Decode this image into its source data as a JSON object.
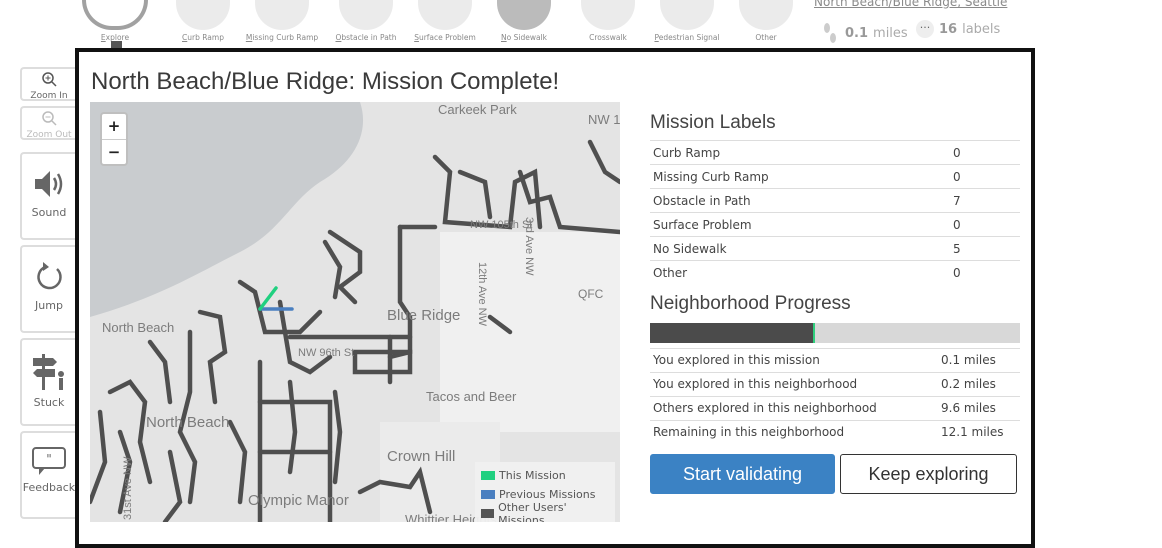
{
  "toolbar": {
    "tools": [
      {
        "label": "Explore",
        "key": "E",
        "rest": "xplore"
      },
      {
        "label": "Curb Ramp",
        "key": "C",
        "rest": "urb Ramp"
      },
      {
        "label": "Missing Curb Ramp",
        "key": "M",
        "rest": "issing Curb Ramp"
      },
      {
        "label": "Obstacle in Path",
        "key": "O",
        "rest": "bstacle in Path"
      },
      {
        "label": "Surface Problem",
        "key": "S",
        "rest": "urface Problem"
      },
      {
        "label": "No Sidewalk",
        "key": "N",
        "rest": "o Sidewalk"
      },
      {
        "label": "Crosswalk",
        "key": "",
        "rest": "Crosswalk"
      },
      {
        "label": "Pedestrian Signal",
        "key": "P",
        "rest": "edestrian Signal"
      },
      {
        "label": "Other",
        "key": "",
        "rest": "Other"
      }
    ],
    "neighborhood_link": "North Beach/Blue Ridge, Seattle",
    "distance_value": "0.1",
    "distance_unit": "miles",
    "labels_value": "16",
    "labels_unit": "labels"
  },
  "sidebar": {
    "zoom_in": "Zoom In",
    "zoom_out": "Zoom Out",
    "sound": "Sound",
    "jump": "Jump",
    "stuck": "Stuck",
    "feedback": "Feedback"
  },
  "modal": {
    "title": "North Beach/Blue Ridge: Mission Complete!",
    "map": {
      "zoom_in": "+",
      "zoom_out": "−",
      "place_labels": {
        "carkeek": "Carkeek Park",
        "nw100": "NW 100",
        "nw105": "NW 105th St",
        "ave3": "3rd Ave NW",
        "ave12": "12th Ave NW",
        "blue_ridge": "Blue Ridge",
        "qfc": "QFC",
        "north_beach_top": "North Beach",
        "nw96": "NW 96th St",
        "north_beach": "North Beach",
        "tacos": "Tacos and Beer",
        "crown_hill": "Crown Hill",
        "olympic": "Olympic Manor",
        "ave31": "31st Ave NW",
        "whittier": "Whittier Heights"
      },
      "legend": [
        {
          "label": "This Mission",
          "color": "#20d080"
        },
        {
          "label": "Previous Missions",
          "color": "#4a7fc0"
        },
        {
          "label": "Other Users' Missions",
          "color": "#555555"
        }
      ]
    },
    "mission_labels": {
      "title": "Mission Labels",
      "rows": [
        {
          "name": "Curb Ramp",
          "count": "0"
        },
        {
          "name": "Missing Curb Ramp",
          "count": "0"
        },
        {
          "name": "Obstacle in Path",
          "count": "7"
        },
        {
          "name": "Surface Problem",
          "count": "0"
        },
        {
          "name": "No Sidewalk",
          "count": "5"
        },
        {
          "name": "Other",
          "count": "0"
        }
      ]
    },
    "neighborhood_progress": {
      "title": "Neighborhood Progress",
      "percent_explored_by_others": 0.44,
      "percent_explored_by_you": 0.006,
      "rows": [
        {
          "name": "You explored in this mission",
          "value": "0.1 miles"
        },
        {
          "name": "You explored in this neighborhood",
          "value": "0.2 miles"
        },
        {
          "name": "Others explored in this neighborhood",
          "value": "9.6 miles"
        },
        {
          "name": "Remaining in this neighborhood",
          "value": "12.1 miles"
        }
      ]
    },
    "buttons": {
      "start_validating": "Start validating",
      "keep_exploring": "Keep exploring"
    }
  }
}
